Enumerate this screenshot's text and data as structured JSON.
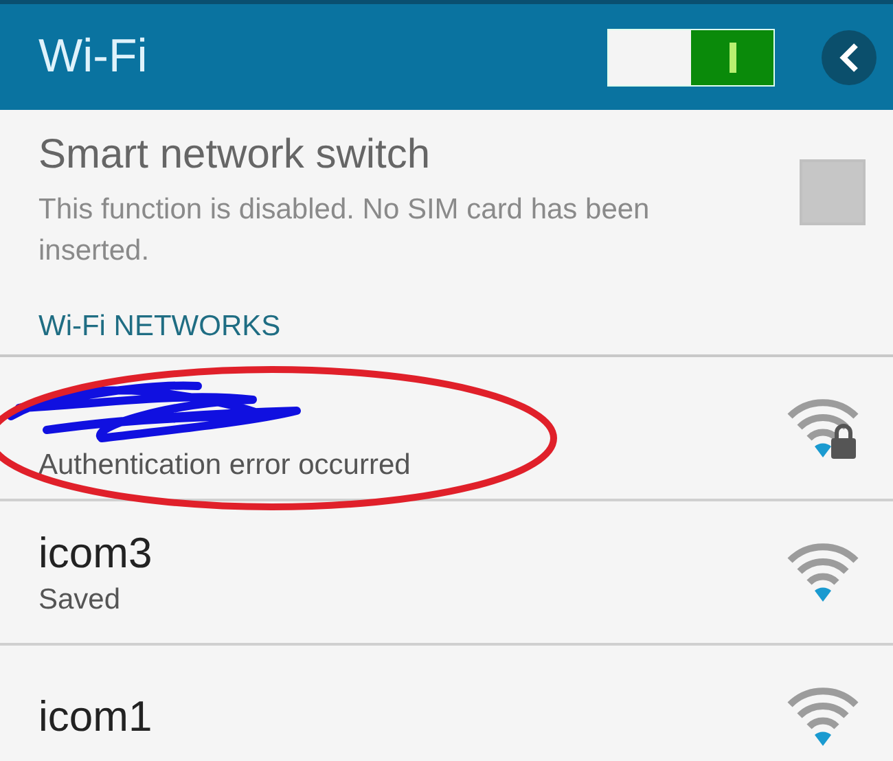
{
  "header": {
    "title": "Wi-Fi",
    "wifi_switch": {
      "on": true
    }
  },
  "smart_switch": {
    "title": "Smart network switch",
    "description": "This function is disabled. No SIM card has been inserted.",
    "checked": false,
    "disabled": true
  },
  "section": {
    "title": "Wi-Fi NETWORKS"
  },
  "networks": [
    {
      "status": "Authentication error occurred",
      "secured": true,
      "circled": true
    },
    {
      "name": "icom3",
      "status": "Saved",
      "secured": false,
      "circled": false
    },
    {
      "name": "icom1",
      "secured": false,
      "circled": false
    }
  ]
}
